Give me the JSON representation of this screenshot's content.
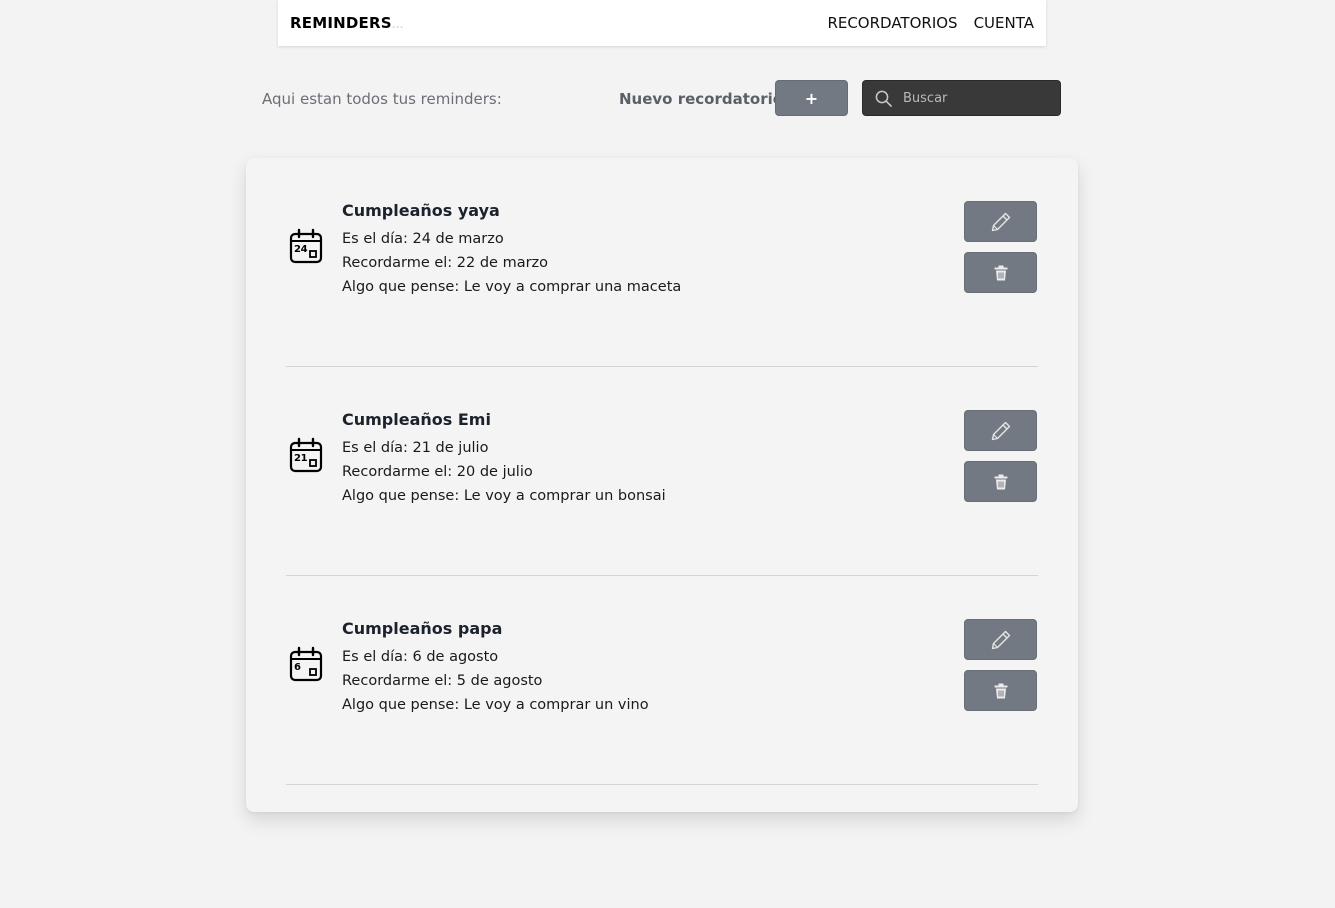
{
  "navbar": {
    "brand": "REMINDERS",
    "brand_dots": "...",
    "links": [
      "RECORDATORIOS",
      "CUENTA"
    ]
  },
  "toolbar": {
    "intro": "Aqui estan todos tus reminders:",
    "new_label": "Nuevo recordatorio:",
    "add_label": "+",
    "search_placeholder": "Buscar"
  },
  "colors": {
    "button": "#737982",
    "search_bg": "#393939",
    "background": "#f3f3f3"
  },
  "reminders": [
    {
      "title": "Cumpleaños yaya",
      "day_number": "24",
      "date": "Es el día: 24 de marzo",
      "remind": "Recordarme el: 22 de marzo",
      "note": "Algo que pense: Le voy a comprar una maceta"
    },
    {
      "title": "Cumpleaños Emi",
      "day_number": "21",
      "date": "Es el día: 21 de julio",
      "remind": "Recordarme el: 20 de julio",
      "note": "Algo que pense: Le voy a comprar un bonsai"
    },
    {
      "title": "Cumpleaños papa",
      "day_number": "6",
      "date": "Es el día: 6 de agosto",
      "remind": "Recordarme el: 5 de agosto",
      "note": "Algo que pense: Le voy a comprar un vino"
    }
  ],
  "icons": {
    "calendar": "calendar-icon",
    "edit": "pencil-icon",
    "delete": "trash-icon",
    "search": "search-icon"
  }
}
